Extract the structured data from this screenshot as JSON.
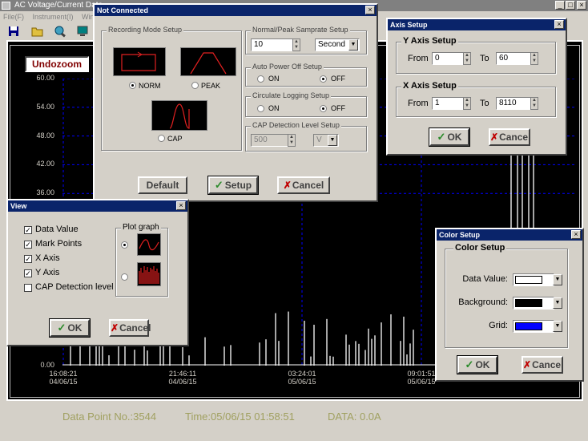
{
  "main": {
    "title": "AC Voltage/Current Data",
    "menu": [
      "File(F)",
      "Instrument(I)",
      "Window"
    ],
    "undozoom_label": "Undozoom",
    "status": {
      "data_point": "Data Point No.:3544",
      "time": "Time:05/06/15 01:58:51",
      "data": "DATA: 0.0A"
    }
  },
  "chart_data": {
    "type": "line",
    "ylim": [
      0,
      60
    ],
    "yticks": [
      "60.00",
      "54.00",
      "48.00",
      "42.00",
      "36.00",
      "0.00"
    ],
    "xticks": [
      {
        "time": "16:08:21",
        "date": "04/06/15"
      },
      {
        "time": "21:46:11",
        "date": "04/06/15"
      },
      {
        "time": "03:24:01",
        "date": "05/06/15"
      },
      {
        "time": "09:01:51",
        "date": "05/06/15"
      }
    ],
    "background": "#000000",
    "grid_color": "#0000ff",
    "series_color": "#ffffff",
    "grid": true
  },
  "recording_dialog": {
    "title": "Not Connected",
    "recording_mode": {
      "label": "Recording  Mode Setup",
      "options": [
        "NORM",
        "PEAK",
        "CAP"
      ],
      "selected": "NORM"
    },
    "samprate": {
      "label": "Normal/Peak Samprate Setup",
      "value": "10",
      "unit": "Second"
    },
    "auto_power_off": {
      "label": "Auto Power Off Setup",
      "on_label": "ON",
      "off_label": "OFF",
      "selected": "OFF"
    },
    "circulate_logging": {
      "label": "Circulate Logging Setup",
      "on_label": "ON",
      "off_label": "OFF",
      "selected": "OFF"
    },
    "cap_detection": {
      "label": "CAP Detection Level Setup",
      "value": "500",
      "unit": "V"
    },
    "default_label": "Default",
    "setup_label": "Setup",
    "cancel_label": "Cancel"
  },
  "axis_dialog": {
    "title": "Axis Setup",
    "y_axis": {
      "label": "Y Axis Setup",
      "from_label": "From",
      "to_label": "To",
      "from": "0",
      "to": "60"
    },
    "x_axis": {
      "label": "X Axis Setup",
      "from_label": "From",
      "to_label": "To",
      "from": "1",
      "to": "8110"
    },
    "ok_label": "OK",
    "cancel_label": "Cancel"
  },
  "view_dialog": {
    "title": "View",
    "checkboxes": [
      {
        "label": "Data Value",
        "checked": true
      },
      {
        "label": "Mark Points",
        "checked": true
      },
      {
        "label": "X Axis",
        "checked": true
      },
      {
        "label": "Y Axis",
        "checked": true
      },
      {
        "label": "CAP Detection level",
        "checked": false
      }
    ],
    "plot_graph_label": "Plot graph",
    "ok_label": "OK",
    "cancel_label": "Cancel"
  },
  "color_dialog": {
    "title": "Color Setup",
    "group_label": "Color Setup",
    "rows": [
      {
        "label": "Data  Value:",
        "color": "#ffffff"
      },
      {
        "label": "Background:",
        "color": "#000000"
      },
      {
        "label": "Grid:",
        "color": "#0000ff"
      }
    ],
    "ok_label": "OK",
    "cancel_label": "Cancel"
  }
}
